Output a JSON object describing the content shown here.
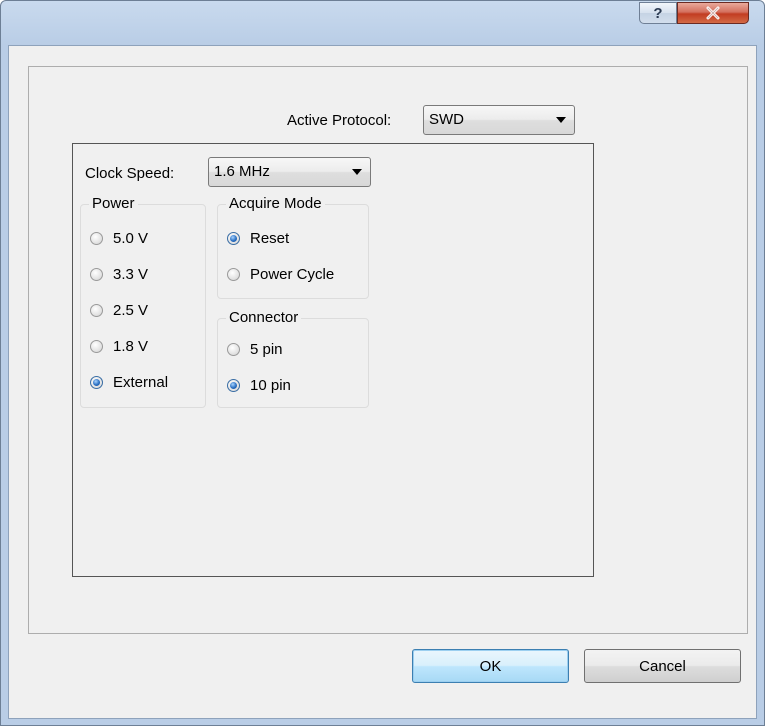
{
  "titlebar": {
    "help_glyph": "?",
    "help_icon": "question-mark-icon",
    "close_icon": "close-x-icon"
  },
  "protocol": {
    "label": "Active Protocol:",
    "value": "SWD"
  },
  "clock": {
    "label": "Clock Speed:",
    "value": "1.6 MHz"
  },
  "power": {
    "title": "Power",
    "options": [
      "5.0 V",
      "3.3 V",
      "2.5 V",
      "1.8 V",
      "External"
    ],
    "selected": "External"
  },
  "acquire": {
    "title": "Acquire Mode",
    "options": [
      "Reset",
      "Power Cycle"
    ],
    "selected": "Reset"
  },
  "connector": {
    "title": "Connector",
    "options": [
      "5 pin",
      "10 pin"
    ],
    "selected": "10 pin"
  },
  "buttons": {
    "ok": "OK",
    "cancel": "Cancel"
  },
  "colors": {
    "accent": "#3c7fb1",
    "close": "#c23c22",
    "frame": "#b9cde6"
  }
}
